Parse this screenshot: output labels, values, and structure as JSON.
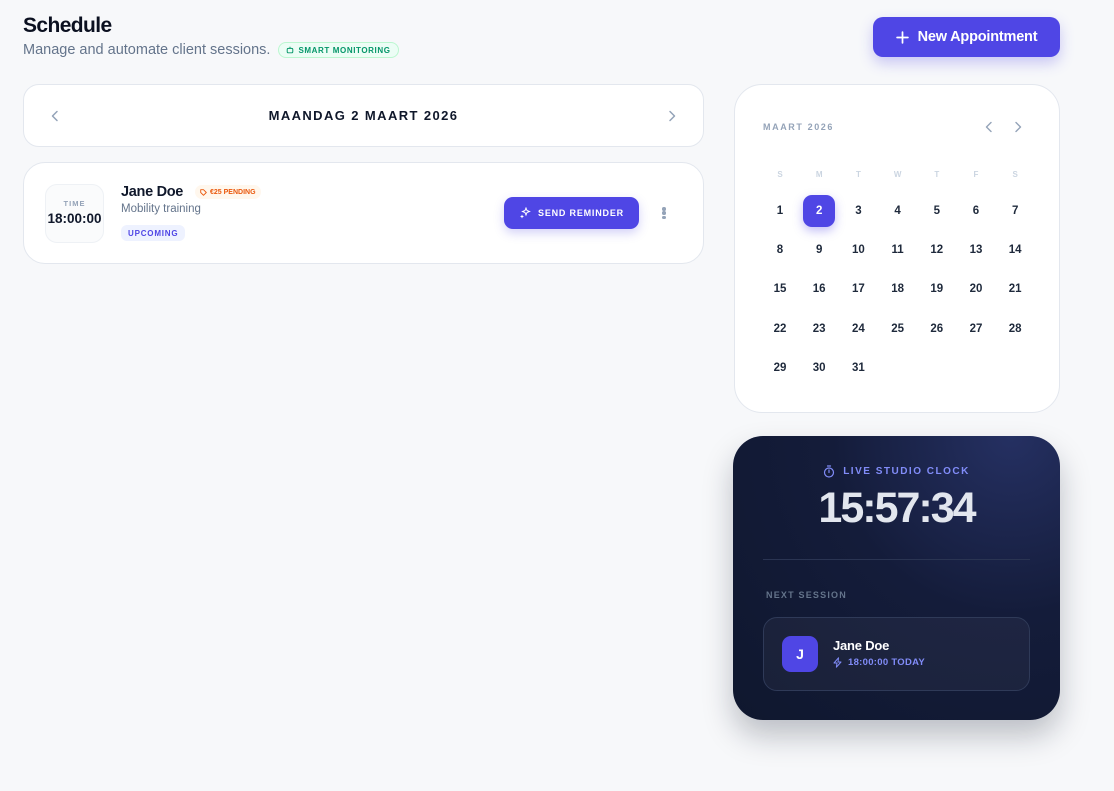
{
  "header": {
    "title": "Schedule",
    "subtitle": "Manage and automate client sessions.",
    "badge": "SMART MONITORING",
    "new_button": "New Appointment"
  },
  "date_nav": {
    "label": "MAANDAG 2 MAART 2026"
  },
  "appointment": {
    "time_label": "TIME",
    "time": "18:00:00",
    "client": "Jane Doe",
    "payment_badge": "€25 PENDING",
    "service": "Mobility training",
    "status": "UPCOMING",
    "reminder_button": "SEND REMINDER"
  },
  "calendar": {
    "month": "MAART 2026",
    "weekdays": [
      "S",
      "M",
      "T",
      "W",
      "T",
      "F",
      "S"
    ],
    "selected_day": 2,
    "first_day_column": 0,
    "days": [
      1,
      2,
      3,
      4,
      5,
      6,
      7,
      8,
      9,
      10,
      11,
      12,
      13,
      14,
      15,
      16,
      17,
      18,
      19,
      20,
      21,
      22,
      23,
      24,
      25,
      26,
      27,
      28,
      29,
      30,
      31
    ]
  },
  "clock": {
    "heading": "LIVE STUDIO CLOCK",
    "time": "15:57:34",
    "next_label": "NEXT SESSION",
    "next": {
      "initial": "J",
      "name": "Jane Doe",
      "when": "18:00:00 TODAY"
    }
  },
  "colors": {
    "accent": "#4f46e5",
    "success": "#059669",
    "warning": "#ea580c",
    "dark": "#0f172e"
  }
}
